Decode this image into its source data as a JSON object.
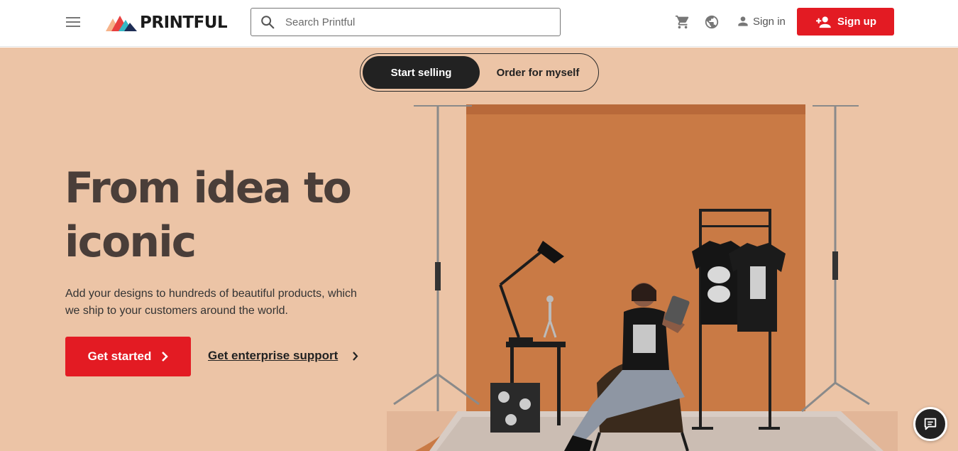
{
  "header": {
    "logo_text": "PRINTFUL",
    "search_placeholder": "Search Printful",
    "signin_label": "Sign in",
    "signup_label": "Sign up",
    "brand_red": "#e31b23"
  },
  "hero": {
    "toggle": {
      "active_label": "Start selling",
      "inactive_label": "Order for myself"
    },
    "headline": "From idea to iconic",
    "subtext": "Add your designs to hundreds of beautiful products, which we ship to your customers around the world.",
    "cta_primary": "Get started",
    "cta_secondary": "Get enterprise support",
    "background_color": "#ecc4a6"
  },
  "icons": [
    "hamburger-icon",
    "search-icon",
    "cart-icon",
    "globe-icon",
    "user-icon",
    "add-user-icon",
    "chevron-right-icon",
    "chat-icon"
  ]
}
